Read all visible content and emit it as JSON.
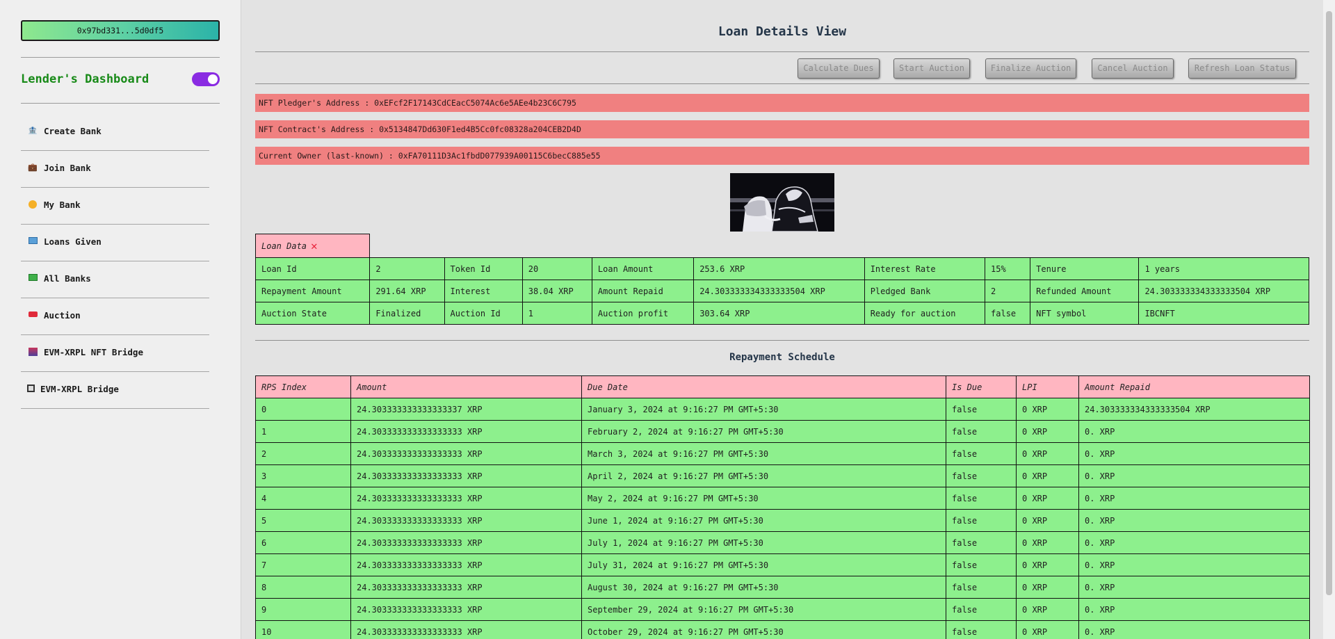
{
  "wallet": {
    "address": "0x97bd331...5d0df5"
  },
  "sidebar": {
    "title": "Lender's Dashboard",
    "items": [
      {
        "label": "Create Bank",
        "icon": "bank-icon"
      },
      {
        "label": "Join Bank",
        "icon": "briefcase-icon"
      },
      {
        "label": "My Bank",
        "icon": "coin-icon"
      },
      {
        "label": "Loans Given",
        "icon": "money-icon"
      },
      {
        "label": "All Banks",
        "icon": "cash-icon"
      },
      {
        "label": "Auction",
        "icon": "gavel-icon"
      },
      {
        "label": "EVM-XRPL NFT Bridge",
        "icon": "bridge-icon"
      },
      {
        "label": "EVM-XRPL Bridge",
        "icon": "framed-picture-icon"
      }
    ]
  },
  "page": {
    "title": "Loan Details View"
  },
  "actions": {
    "calculate_dues": "Calculate Dues",
    "start_auction": "Start Auction",
    "finalize_auction": "Finalize Auction",
    "cancel_auction": "Cancel Auction",
    "refresh_status": "Refresh Loan Status"
  },
  "addresses": {
    "pledger": "NFT Pledger's Address : 0xEFcf2F17143CdCEacC5074Ac6e5AEe4b23C6C795",
    "contract": "NFT Contract's Address : 0x5134847Dd630F1ed4B5Cc0fc08328a204CEB2D4D",
    "owner": "Current Owner (last-known) : 0xFA70111D3Ac1fbdD077939A00115C6becC885e55"
  },
  "loan_data": {
    "tab_label": "Loan Data",
    "rows": [
      [
        "Loan Id",
        "2",
        "Token Id",
        "20",
        "Loan Amount",
        "253.6 XRP",
        "Interest Rate",
        "15%",
        "Tenure",
        "1 years"
      ],
      [
        "Repayment Amount",
        "291.64 XRP",
        "Interest",
        "38.04 XRP",
        "Amount Repaid",
        "24.303333334333333504 XRP",
        "Pledged Bank",
        "2",
        "Refunded Amount",
        "24.303333334333333504 XRP"
      ],
      [
        "Auction State",
        "Finalized",
        "Auction Id",
        "1",
        "Auction profit",
        "303.64 XRP",
        "Ready for auction",
        "false",
        "NFT symbol",
        "IBCNFT"
      ]
    ]
  },
  "repayment": {
    "title": "Repayment Schedule",
    "headers": [
      "RPS Index",
      "Amount",
      "Due Date",
      "Is Due",
      "LPI",
      "Amount Repaid"
    ],
    "rows": [
      [
        "0",
        "24.303333333333333337 XRP",
        "January 3, 2024 at 9:16:27 PM GMT+5:30",
        "false",
        "0 XRP",
        "24.303333334333333504 XRP"
      ],
      [
        "1",
        "24.303333333333333333 XRP",
        "February 2, 2024 at 9:16:27 PM GMT+5:30",
        "false",
        "0 XRP",
        "0. XRP"
      ],
      [
        "2",
        "24.303333333333333333 XRP",
        "March 3, 2024 at 9:16:27 PM GMT+5:30",
        "false",
        "0 XRP",
        "0. XRP"
      ],
      [
        "3",
        "24.303333333333333333 XRP",
        "April 2, 2024 at 9:16:27 PM GMT+5:30",
        "false",
        "0 XRP",
        "0. XRP"
      ],
      [
        "4",
        "24.303333333333333333 XRP",
        "May 2, 2024 at 9:16:27 PM GMT+5:30",
        "false",
        "0 XRP",
        "0. XRP"
      ],
      [
        "5",
        "24.303333333333333333 XRP",
        "June 1, 2024 at 9:16:27 PM GMT+5:30",
        "false",
        "0 XRP",
        "0. XRP"
      ],
      [
        "6",
        "24.303333333333333333 XRP",
        "July 1, 2024 at 9:16:27 PM GMT+5:30",
        "false",
        "0 XRP",
        "0. XRP"
      ],
      [
        "7",
        "24.303333333333333333 XRP",
        "July 31, 2024 at 9:16:27 PM GMT+5:30",
        "false",
        "0 XRP",
        "0. XRP"
      ],
      [
        "8",
        "24.303333333333333333 XRP",
        "August 30, 2024 at 9:16:27 PM GMT+5:30",
        "false",
        "0 XRP",
        "0. XRP"
      ],
      [
        "9",
        "24.303333333333333333 XRP",
        "September 29, 2024 at 9:16:27 PM GMT+5:30",
        "false",
        "0 XRP",
        "0. XRP"
      ],
      [
        "10",
        "24.303333333333333333 XRP",
        "October 29, 2024 at 9:16:27 PM GMT+5:30",
        "false",
        "0 XRP",
        "0. XRP"
      ]
    ]
  },
  "colors": {
    "accent_green": "#188a18",
    "toggle_purple": "#8a2be2",
    "address_bar": "#f08080",
    "table_green": "#8df08d",
    "header_pink": "#ffb6c1"
  }
}
